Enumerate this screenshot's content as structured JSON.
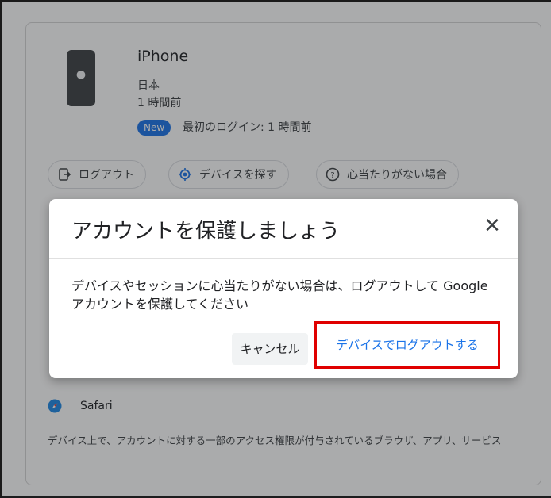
{
  "device": {
    "name": "iPhone",
    "country": "日本",
    "last_active": "1 時間前",
    "new_badge": "New",
    "first_login": "最初のログイン: 1 時間前"
  },
  "actions": [
    {
      "label": "ログアウト",
      "icon": "logout-icon"
    },
    {
      "label": "デバイスを探す",
      "icon": "locate-icon"
    },
    {
      "label": "心当たりがない場合",
      "icon": "help-icon"
    }
  ],
  "access": {
    "app_label": "Safari",
    "app_icon": "safari-compass-icon",
    "description": "デバイス上で、アカウントに対する一部のアクセス権限が付与されているブラウザ、アプリ、サービス"
  },
  "dialog": {
    "title": "アカウントを保護しましょう",
    "close_icon": "close-icon",
    "body": "デバイスやセッションに心当たりがない場合は、ログアウトして Google アカウントを保護してください",
    "cancel_label": "キャンセル",
    "confirm_label": "デバイスでログアウトする"
  },
  "colors": {
    "accent": "#1a73e8",
    "highlight": "#e00000"
  }
}
